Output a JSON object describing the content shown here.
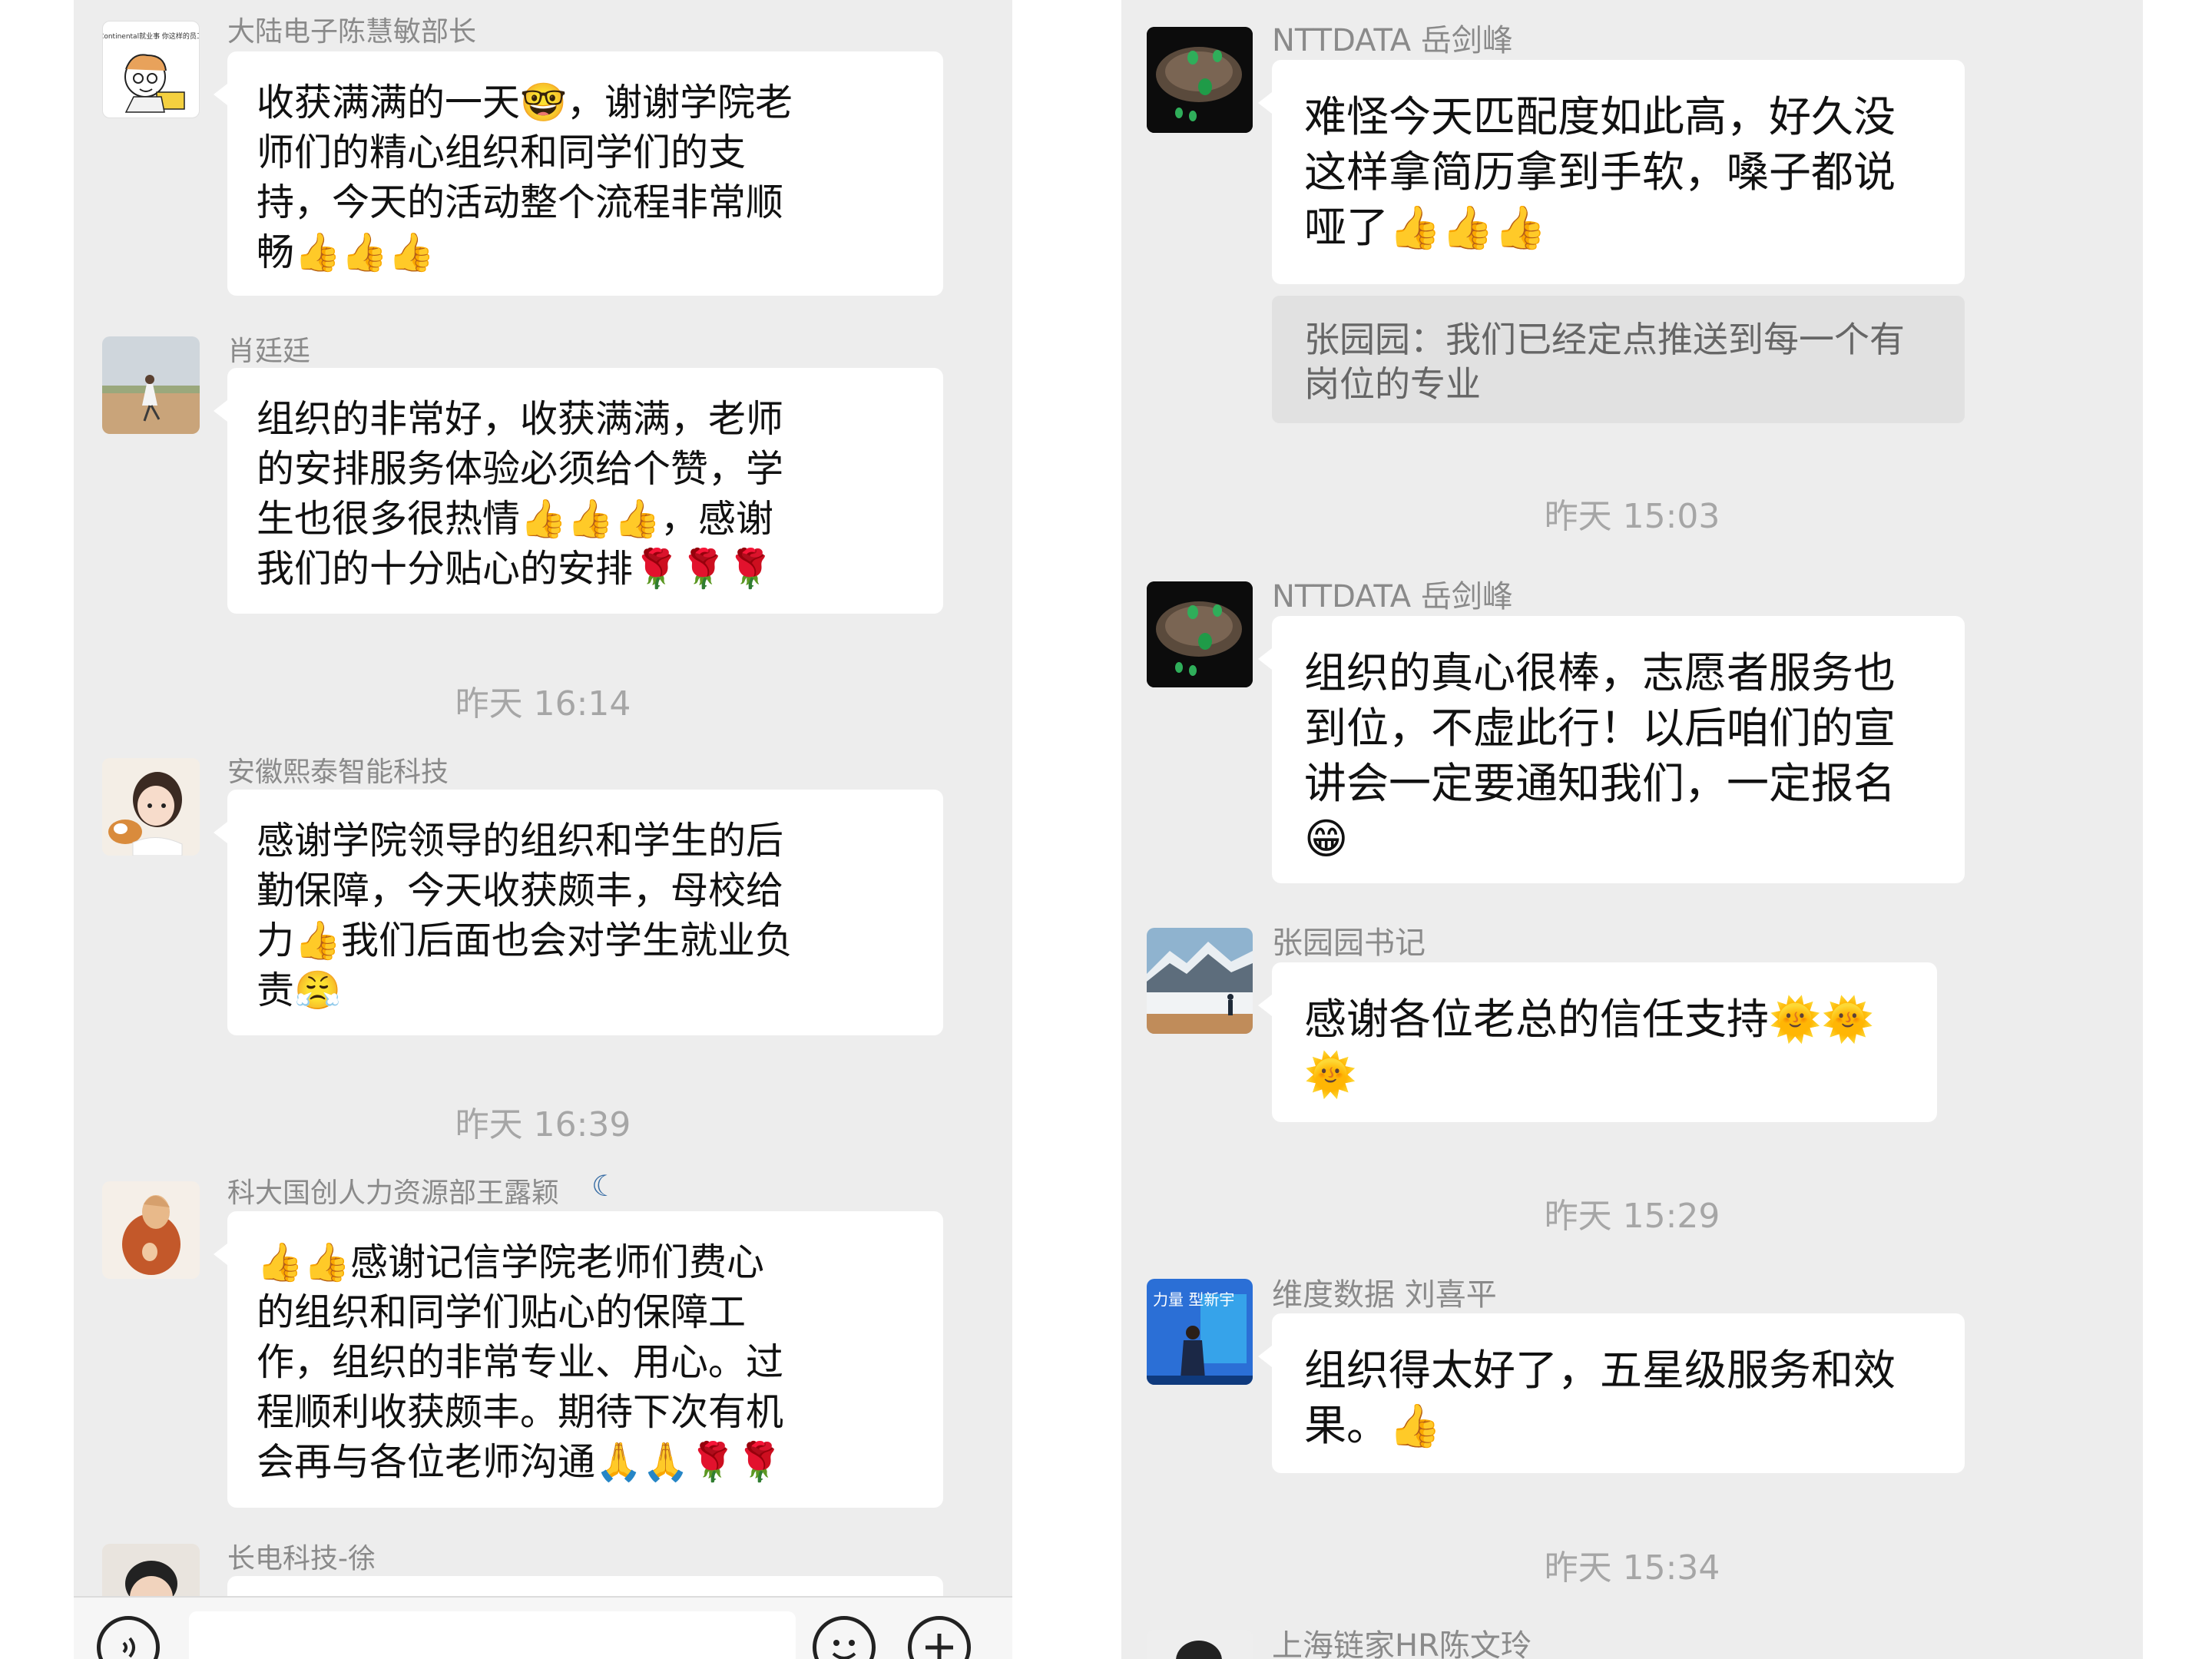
{
  "left_chat": {
    "messages": [
      {
        "sender": "大陆电子陈慧敏部长",
        "text": "收获满满的一天🤓，谢谢学院老\n师们的精心组织和同学们的支\n持，今天的活动整个流程非常顺\n畅👍👍👍",
        "avatar_text": "Continental就业事 你这样的员工"
      },
      {
        "sender": "肖廷廷",
        "text": "组织的非常好，收获满满，老师\n的安排服务体验必须给个赞，学\n生也很多很热情👍👍👍，感谢\n我们的十分贴心的安排🌹🌹🌹"
      },
      {
        "sender": "安徽熙泰智能科技",
        "text": "感谢学院领导的组织和学生的后\n勤保障，今天收获颇丰，母校给\n力👍我们后面也会对学生就业负\n责😤"
      },
      {
        "sender": "科大国创人力资源部王露颖",
        "text": "👍👍感谢记信学院老师们费心\n的组织和同学们贴心的保障工\n作，组织的非常专业、用心。过\n程顺利收获颇丰。期待下次有机\n会再与各位老师沟通🙏🙏🌹🌹"
      },
      {
        "sender": "长电科技-徐"
      }
    ],
    "times": [
      "昨天 16:14",
      "昨天 16:39"
    ]
  },
  "right_chat": {
    "messages": [
      {
        "sender": "NTTDATA 岳剑峰",
        "text": "难怪今天匹配度如此高，好久没\n这样拿简历拿到手软，嗓子都说\n哑了👍👍👍",
        "quote": "张园园：我们已经定点推送到每一个有\n岗位的专业"
      },
      {
        "sender": "NTTDATA 岳剑峰",
        "text": "组织的真心很棒，志愿者服务也\n到位，不虚此行！以后咱们的宣\n讲会一定要通知我们，一定报名\n😁"
      },
      {
        "sender": "张园园书记",
        "text": "感谢各位老总的信任支持🌞🌞\n🌞"
      },
      {
        "sender": "维度数据 刘喜平",
        "text": "组织得太好了，五星级服务和效\n果。👍",
        "avatar_text": "力量 型新宇"
      },
      {
        "sender": "上海链家HR陈文玲"
      }
    ],
    "times": [
      "昨天 15:03",
      "昨天 15:29",
      "昨天 15:34"
    ]
  },
  "colors": {
    "chat_bg": "#ededed",
    "bubble_bg": "#ffffff",
    "quote_bg": "#e1e1e1",
    "sender_text": "#8a8a8a",
    "time_text": "#a6a6a6"
  },
  "icons": [
    "voice-icon",
    "emoji-icon",
    "plus-icon"
  ]
}
